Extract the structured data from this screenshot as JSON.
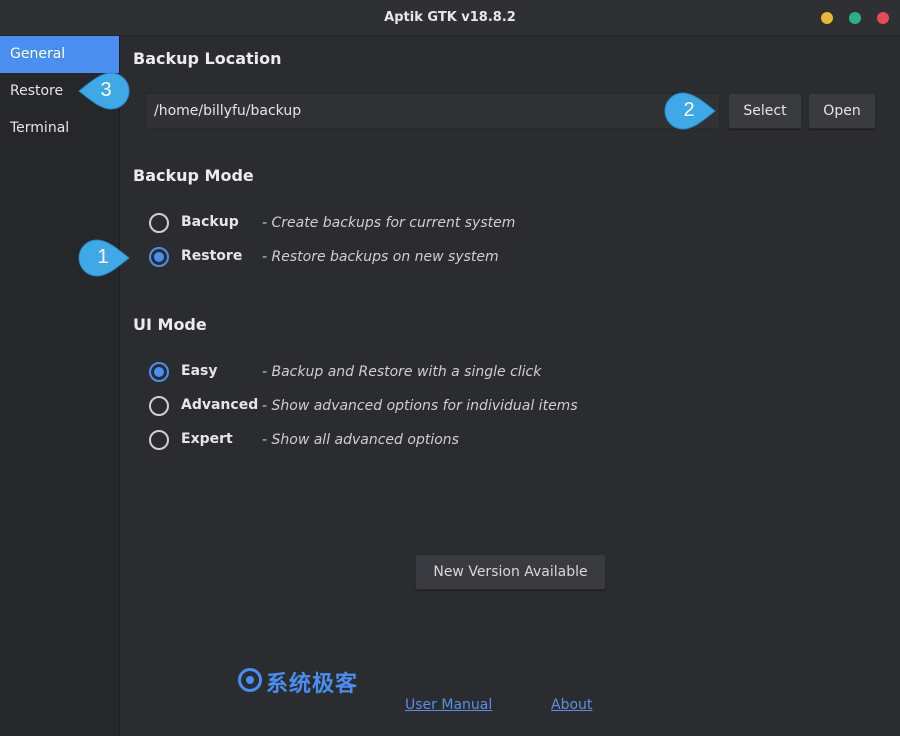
{
  "window": {
    "title": "Aptik GTK v18.8.2"
  },
  "sidebar": {
    "items": [
      {
        "label": "General"
      },
      {
        "label": "Restore"
      },
      {
        "label": "Terminal"
      }
    ]
  },
  "backup_location": {
    "heading": "Backup Location",
    "path": "/home/billyfu/backup",
    "select_label": "Select",
    "open_label": "Open"
  },
  "backup_mode": {
    "heading": "Backup Mode",
    "options": [
      {
        "label": "Backup",
        "desc": "- Create backups for current system",
        "checked": false
      },
      {
        "label": "Restore",
        "desc": "- Restore backups on new system",
        "checked": true
      }
    ]
  },
  "ui_mode": {
    "heading": "UI Mode",
    "options": [
      {
        "label": "Easy",
        "desc": "- Backup and Restore with a single click",
        "checked": true
      },
      {
        "label": "Advanced",
        "desc": "- Show advanced options for individual items",
        "checked": false
      },
      {
        "label": "Expert",
        "desc": "- Show all advanced options",
        "checked": false
      }
    ]
  },
  "footer": {
    "new_version_label": "New Version Available",
    "user_manual_label": "User Manual",
    "about_label": "About"
  },
  "watermark": {
    "text": "系统极客"
  },
  "callouts": [
    {
      "label": "1"
    },
    {
      "label": "2"
    },
    {
      "label": "3"
    }
  ],
  "colors": {
    "accent": "#4a8ff0",
    "callout": "#3fa9e8",
    "background": "#2b2c30",
    "sidebar": "#26272a"
  }
}
